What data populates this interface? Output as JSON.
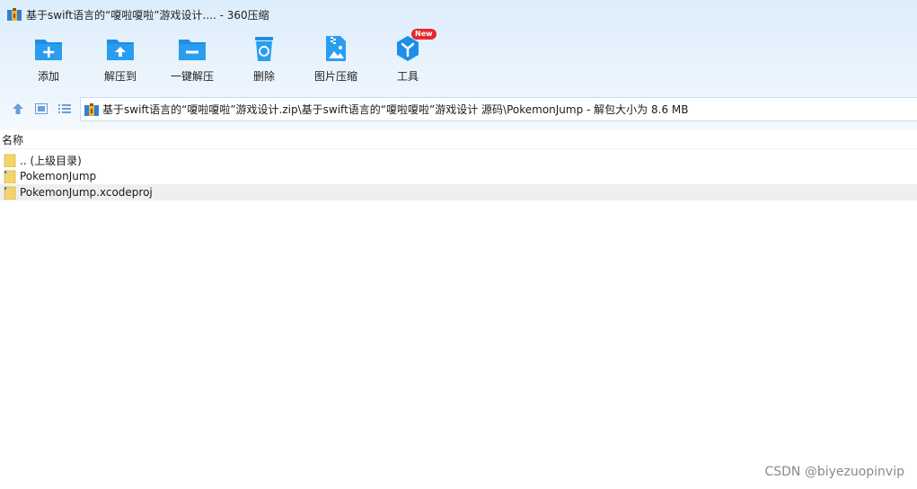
{
  "window": {
    "title": "基于swift语言的“嗄啦嗄啦”游戏设计.... - 360压缩"
  },
  "toolbar": {
    "items": [
      {
        "label": "添加",
        "icon": "add-folder-icon"
      },
      {
        "label": "解压到",
        "icon": "extract-to-icon"
      },
      {
        "label": "一键解压",
        "icon": "one-click-extract-icon"
      },
      {
        "label": "删除",
        "icon": "recycle-bin-icon"
      },
      {
        "label": "图片压缩",
        "icon": "image-compress-icon"
      },
      {
        "label": "工具",
        "icon": "tools-icon",
        "badge": "New"
      }
    ]
  },
  "address_bar": {
    "path": "基于swift语言的“嗄啦嗄啦”游戏设计.zip\\基于swift语言的“嗄啦嗄啦”游戏设计 源码\\PokemonJump - 解包大小为 8.6 MB"
  },
  "file_table": {
    "column_name": "名称",
    "rows": [
      {
        "name": ".. (上级目录)",
        "type": "folder"
      },
      {
        "name": "PokemonJump",
        "type": "folder"
      },
      {
        "name": "PokemonJump.xcodeproj",
        "type": "folder"
      }
    ]
  },
  "watermark": "CSDN @biyezuopinvip",
  "colors": {
    "accent_blue": "#1e8ee8",
    "folder_yellow": "#f6d36b",
    "badge_red": "#e8262d"
  }
}
